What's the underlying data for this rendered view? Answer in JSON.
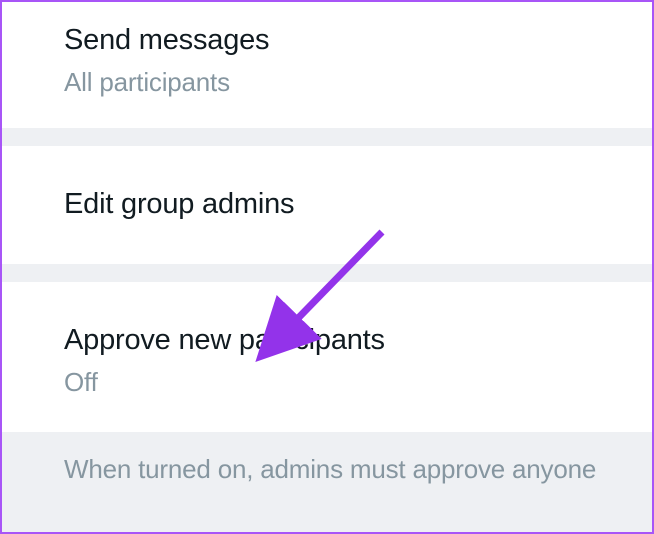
{
  "settings": {
    "sendMessages": {
      "title": "Send messages",
      "value": "All participants"
    },
    "editAdmins": {
      "title": "Edit group admins"
    },
    "approveParticipants": {
      "title": "Approve new participants",
      "value": "Off"
    },
    "footerNote": "When turned on, admins must approve anyone"
  }
}
